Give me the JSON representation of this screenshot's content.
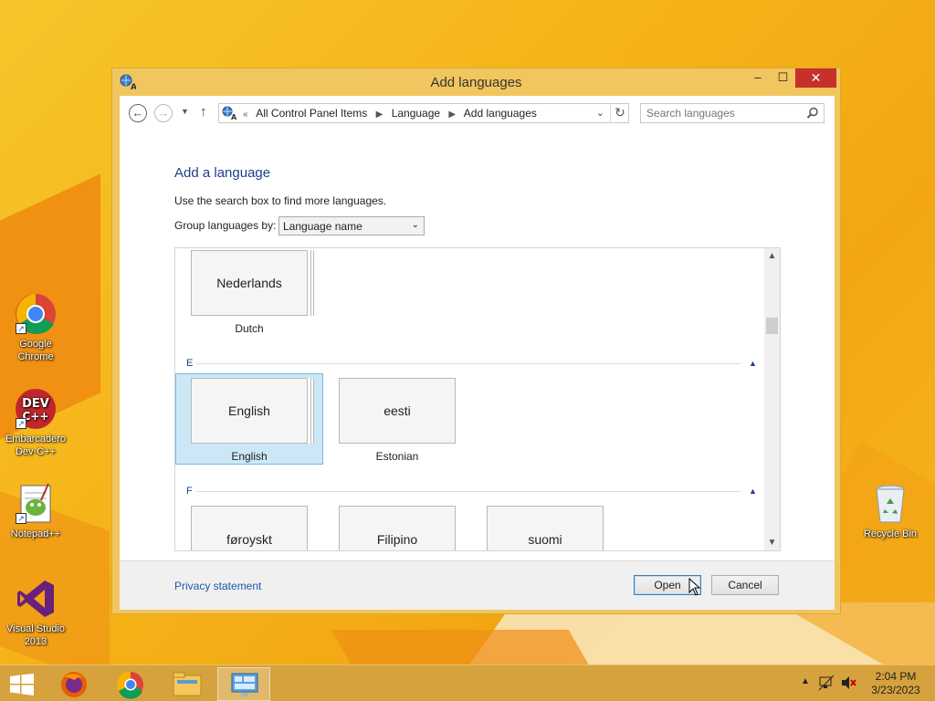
{
  "desktop": {
    "icons": [
      {
        "label": "Google Chrome"
      },
      {
        "label": "Embarcadero Dev-C++"
      },
      {
        "label": "Notepad++"
      },
      {
        "label": "Visual Studio 2013"
      },
      {
        "label": "Recycle Bin"
      }
    ]
  },
  "window": {
    "title": "Add languages",
    "controls": {
      "minimize": "–",
      "maximize": "☐",
      "close": "✕"
    }
  },
  "address": {
    "prefix": "«",
    "crumbs": [
      "All Control Panel Items",
      "Language",
      "Add languages"
    ],
    "search_placeholder": "Search languages"
  },
  "main": {
    "heading": "Add a language",
    "info": "Use the search box to find more languages.",
    "group_label": "Group languages by:",
    "group_value": "Language name"
  },
  "list": {
    "groups": [
      {
        "letter": "E"
      },
      {
        "letter": "F"
      }
    ],
    "tiles": [
      {
        "native": "Nederlands",
        "english": "Dutch"
      },
      {
        "native": "English",
        "english": "English",
        "selected": true
      },
      {
        "native": "eesti",
        "english": "Estonian"
      },
      {
        "native": "føroyskt",
        "english": ""
      },
      {
        "native": "Filipino",
        "english": ""
      },
      {
        "native": "suomi",
        "english": ""
      }
    ]
  },
  "footer": {
    "privacy": "Privacy statement",
    "open": "Open",
    "cancel": "Cancel"
  },
  "taskbar": {
    "time": "2:04 PM",
    "date": "3/23/2023",
    "tray_arrow": "▲"
  },
  "colors": {
    "accent": "#1e3f87",
    "selection": "#cce8f7",
    "close_button": "#c7302b",
    "desktop": "#f5b418"
  }
}
